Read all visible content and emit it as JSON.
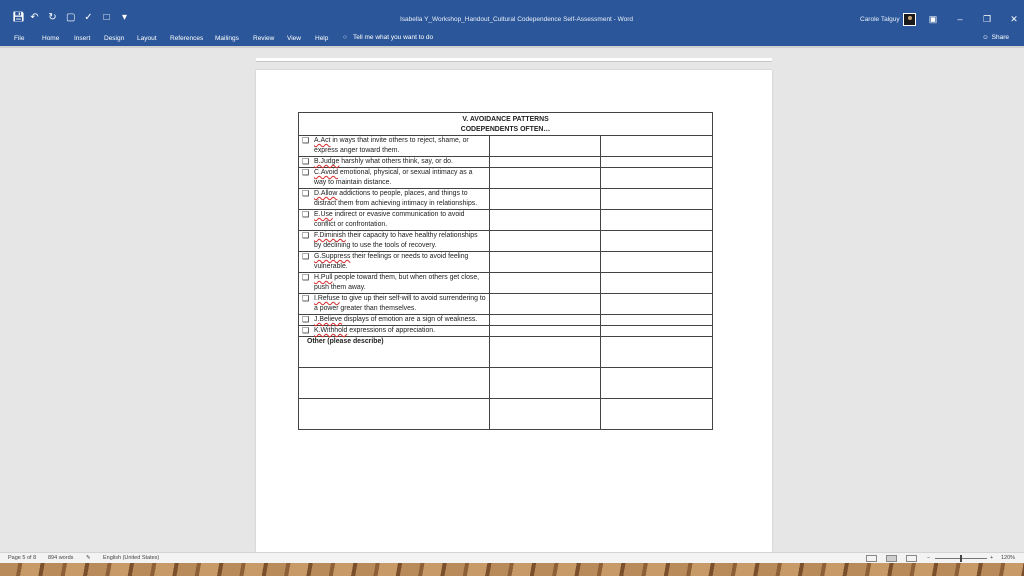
{
  "window": {
    "title": "Isabella Y_Workshop_Handout_Cultural Codependence Self-Assessment  -  Word",
    "user_name": "Carole Talguy",
    "qat_icons": [
      "save-icon",
      "undo-icon",
      "redo-icon",
      "print-preview-icon",
      "spelling-icon",
      "new-doc-icon",
      "customize-qat-icon"
    ],
    "controls": [
      "ribbon-display-icon",
      "minimize-icon",
      "restore-icon",
      "close-icon"
    ]
  },
  "ribbon": {
    "tabs": [
      "File",
      "Home",
      "Insert",
      "Design",
      "Layout",
      "References",
      "Mailings",
      "Review",
      "View",
      "Help"
    ],
    "tell_me": "Tell me what you want to do",
    "share": "Share"
  },
  "table": {
    "title_line1": "V. AVOIDANCE PATTERNS",
    "title_line2": "CODEPENDENTS OFTEN…",
    "items": [
      {
        "lead": "A.Act",
        "text": " in ways that invite others to reject, shame, or express anger toward them."
      },
      {
        "lead": "B.Judge",
        "text": " harshly what others think, say, or do."
      },
      {
        "lead": "C.Avoid",
        "text": " emotional, physical, or sexual intimacy as a way to maintain distance."
      },
      {
        "lead": "D.Allow",
        "text": " addictions to people, places, and things to distract them from achieving intimacy in relationships."
      },
      {
        "lead": "E.Use",
        "text": " indirect or evasive communication to avoid conflict or confrontation."
      },
      {
        "lead": "F.Diminish",
        "text": " their capacity to have healthy relationships by declining to use the tools of recovery."
      },
      {
        "lead": "G.Suppress",
        "text": " their feelings or needs to avoid feeling vulnerable."
      },
      {
        "lead": "H.Pull",
        "text": " people toward them, but when others get close, push them away."
      },
      {
        "lead": "I.Refuse",
        "text": " to give up their self-will to avoid surrendering to a power greater than themselves."
      },
      {
        "lead": "J.Believe",
        "text": " displays of emotion are a sign of weakness."
      },
      {
        "lead": "K.Withhold",
        "text": " expressions of appreciation."
      }
    ],
    "checkbox_glyph": "❑",
    "other_label": "Other (please describe)"
  },
  "status": {
    "page": "Page 5 of 8",
    "words": "894 words",
    "language": "English (United States)",
    "zoom_minus": "−",
    "zoom_plus": "+",
    "zoom": "120%"
  }
}
